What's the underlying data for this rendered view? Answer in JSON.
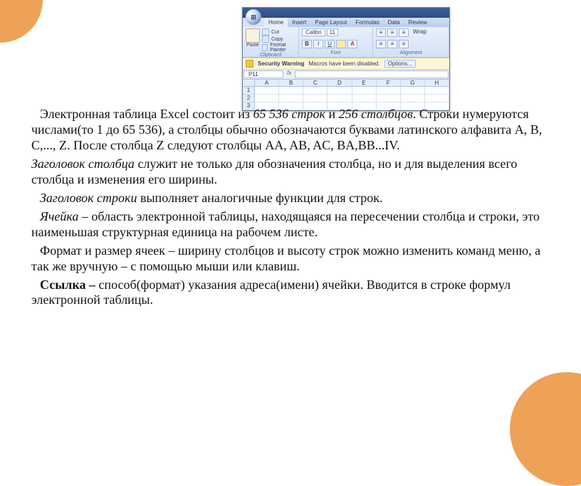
{
  "excel": {
    "orb": "⊞",
    "tabs": [
      "Home",
      "Insert",
      "Page Layout",
      "Formulas",
      "Data",
      "Review"
    ],
    "active_tab": 0,
    "clipboard": {
      "paste": "Paste",
      "cut": "Cut",
      "copy": "Copy",
      "painter": "Format Painter",
      "title": "Clipboard"
    },
    "font": {
      "name": "Calibri",
      "size": "11",
      "title": "Font",
      "b": "B",
      "i": "I",
      "u": "U"
    },
    "alignment": {
      "wrap": "Wrap",
      "title": "Alignment"
    },
    "warn": {
      "title": "Security Warning",
      "msg": "Macros have been disabled.",
      "btn": "Options..."
    },
    "namebox": "P11",
    "fx": "fx",
    "cols": [
      "A",
      "B",
      "C",
      "D",
      "E",
      "F",
      "G",
      "H"
    ],
    "rows": [
      "1",
      "2",
      "3"
    ]
  },
  "text": {
    "p1a": "Электронная таблица Excel состоит из ",
    "p1b": "65 536 строк",
    "p1c": " и ",
    "p1d": "256 столбцов",
    "p1e": ". Строки нумеруются числами(то 1 до 65 536), а столбцы обычно обозначаются буквами латинского алфавита A, B, C,..., Z. После столбца Z следуют столбцы AA, AB, AC, BA,BB...IV.",
    "p2a": "Заголовок столбца",
    "p2b": " служит не только для обозначения столбца, но и для выделения всего столбца и изменения его ширины.",
    "p3a": "Заголовок строки",
    "p3b": " выполняет аналогичные функции для строк.",
    "p4a": "Ячейка",
    "p4b": " – область электронной таблицы, находящаяся на пересечении столбца и строки, это наименьшая структурная единица на рабочем листе.",
    "p5": "Формат и размер ячеек – ширину столбцов и высоту строк можно изменить команд меню, а так же вручную – с помощью мыши или клавиш.",
    "p6a": "Ссылка – ",
    "p6b": "способ(формат) указания адреса(имени) ячейки. Вводится в строке формул электронной таблицы."
  }
}
